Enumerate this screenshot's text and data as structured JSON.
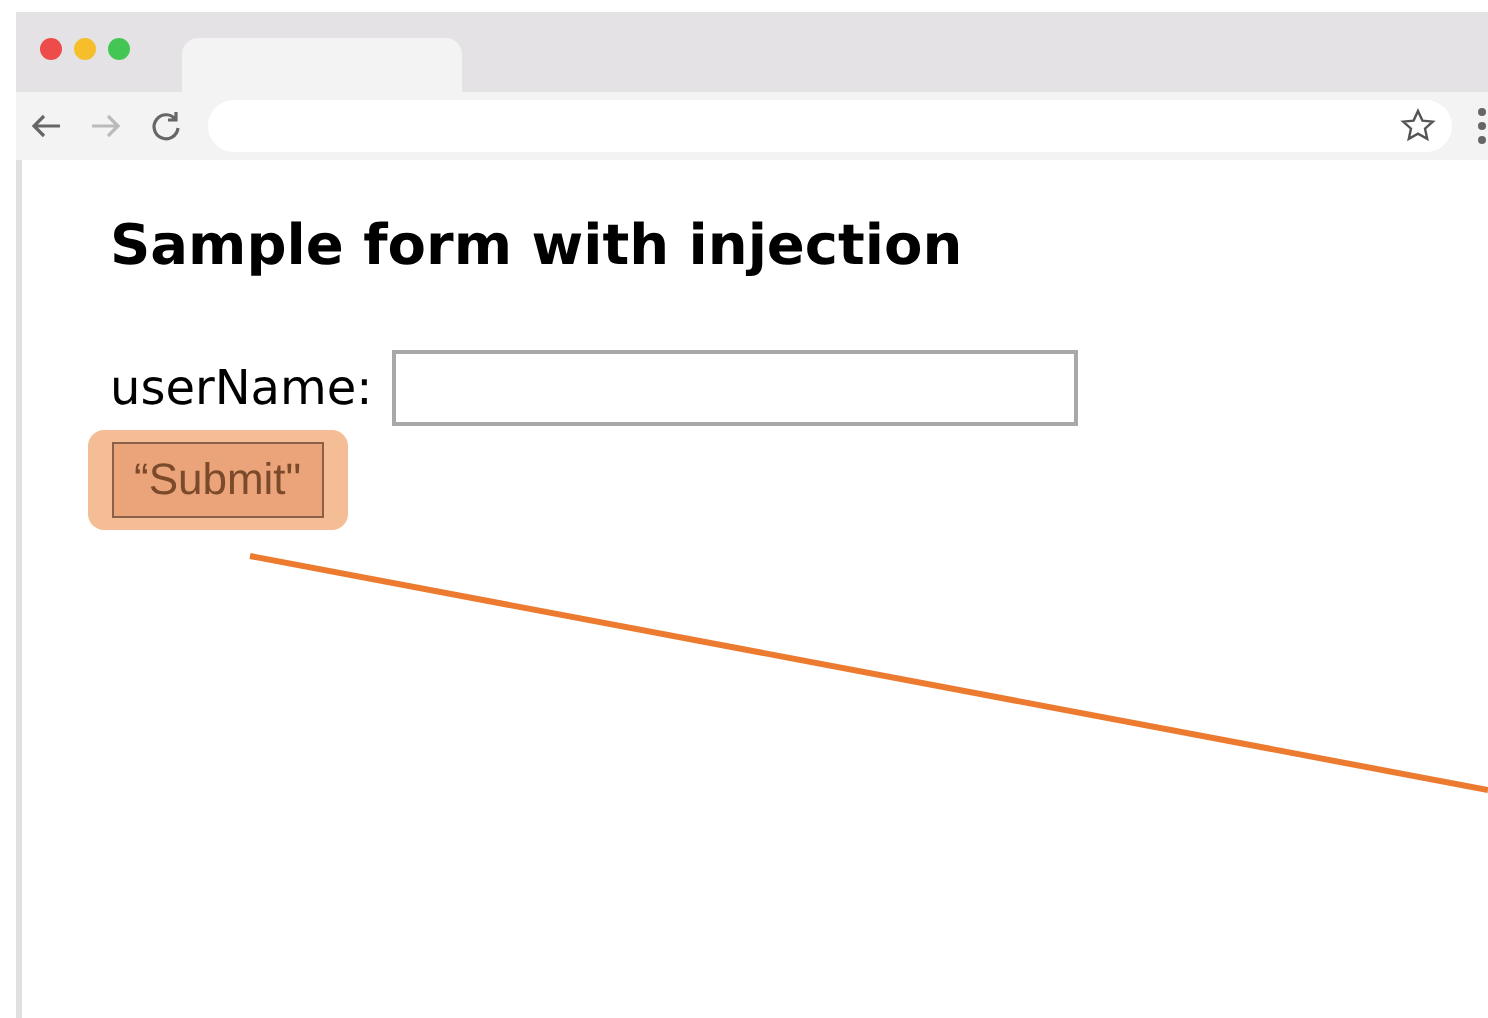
{
  "page": {
    "heading": "Sample form with injection",
    "field": {
      "label": "userName:"
    },
    "button": {
      "label": "“Submit\"",
      "highlighted": true
    }
  }
}
